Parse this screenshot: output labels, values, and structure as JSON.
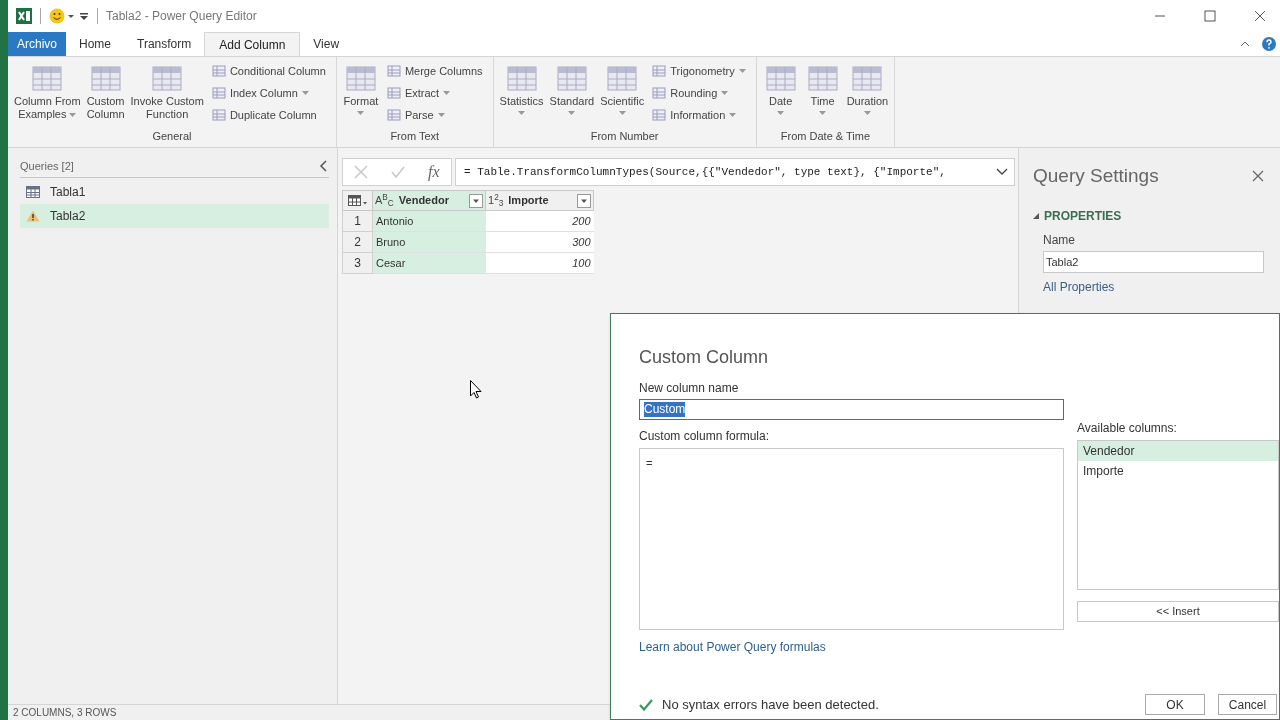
{
  "window": {
    "title": "Tabla2 - Power Query Editor"
  },
  "ribbon_tabs": [
    {
      "label": "Archivo",
      "kind": "file",
      "selected": false
    },
    {
      "label": "Home",
      "kind": "tab",
      "selected": false
    },
    {
      "label": "Transform",
      "kind": "tab",
      "selected": false
    },
    {
      "label": "Add Column",
      "kind": "tab",
      "selected": true
    },
    {
      "label": "View",
      "kind": "tab",
      "selected": false
    }
  ],
  "ribbon_groups": [
    {
      "label": "General",
      "items": [
        {
          "kind": "large",
          "lines": [
            "Column From",
            "Examples"
          ],
          "dropdown": true
        },
        {
          "kind": "large",
          "lines": [
            "Custom",
            "Column"
          ],
          "dropdown": false
        },
        {
          "kind": "large",
          "lines": [
            "Invoke Custom",
            "Function"
          ],
          "dropdown": false
        },
        {
          "kind": "small",
          "label": "Conditional Column",
          "dropdown": false
        },
        {
          "kind": "small",
          "label": "Index Column",
          "dropdown": true
        },
        {
          "kind": "small",
          "label": "Duplicate Column",
          "dropdown": false
        }
      ]
    },
    {
      "label": "From Text",
      "items": [
        {
          "kind": "large",
          "lines": [
            "Format"
          ],
          "dropdown": true
        },
        {
          "kind": "small",
          "label": "Merge Columns",
          "dropdown": false
        },
        {
          "kind": "small",
          "label": "Extract",
          "dropdown": true
        },
        {
          "kind": "small",
          "label": "Parse",
          "dropdown": true
        }
      ]
    },
    {
      "label": "From Number",
      "items": [
        {
          "kind": "large",
          "lines": [
            "Statistics"
          ],
          "dropdown": true
        },
        {
          "kind": "large",
          "lines": [
            "Standard"
          ],
          "dropdown": true
        },
        {
          "kind": "large",
          "lines": [
            "Scientific"
          ],
          "dropdown": true
        },
        {
          "kind": "small",
          "label": "Trigonometry",
          "dropdown": true
        },
        {
          "kind": "small",
          "label": "Rounding",
          "dropdown": true
        },
        {
          "kind": "small",
          "label": "Information",
          "dropdown": true
        }
      ]
    },
    {
      "label": "From Date & Time",
      "items": [
        {
          "kind": "large",
          "lines": [
            "Date"
          ],
          "dropdown": true
        },
        {
          "kind": "large",
          "lines": [
            "Time"
          ],
          "dropdown": true
        },
        {
          "kind": "large",
          "lines": [
            "Duration"
          ],
          "dropdown": true
        }
      ]
    }
  ],
  "queries": {
    "title": "Queries [2]",
    "items": [
      {
        "label": "Tabla1",
        "kind": "table",
        "selected": false
      },
      {
        "label": "Tabla2",
        "kind": "warning",
        "selected": true
      }
    ]
  },
  "formula_bar": {
    "fx": "fx",
    "formula": "= Table.TransformColumnTypes(Source,{{\"Vendedor\", type text}, {\"Importe\","
  },
  "table": {
    "columns": [
      {
        "type": "A$^{B}$$_{C}$",
        "label": "Vendedor",
        "selected": true
      },
      {
        "type": "1$^{2}$$_{3}$",
        "label": "Importe",
        "selected": false
      }
    ],
    "rows": [
      {
        "number": "1",
        "cells": [
          "Antonio",
          "200"
        ]
      },
      {
        "number": "2",
        "cells": [
          "Bruno",
          "300"
        ]
      },
      {
        "number": "3",
        "cells": [
          "Cesar",
          "100"
        ]
      }
    ]
  },
  "query_settings": {
    "title": "Query Settings",
    "section": "PROPERTIES",
    "name_label": "Name",
    "name_value": "Tabla2",
    "link": "All Properties"
  },
  "dialog": {
    "title": "Custom Column",
    "name_label": "New column name",
    "name_value": "Custom",
    "formula_label": "Custom column formula:",
    "formula": "=",
    "columns_label": "Available columns:",
    "columns": [
      {
        "label": "Vendedor",
        "selected": true
      },
      {
        "label": "Importe",
        "selected": false
      }
    ],
    "insert": "<< Insert",
    "link": "Learn about Power Query formulas",
    "status": "No syntax errors have been detected.",
    "ok": "OK",
    "cancel": "Cancel"
  },
  "status_bar": "2 COLUMNS, 3 ROWS"
}
